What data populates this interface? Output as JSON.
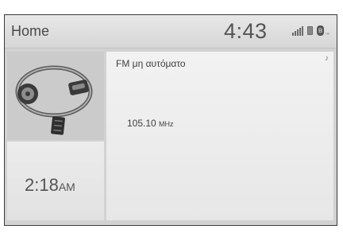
{
  "header": {
    "title": "Home",
    "clock": "4:43"
  },
  "status_icons": [
    "signal-bars-icon",
    "phone-battery-icon",
    "bluetooth-icon",
    "dots-icon"
  ],
  "clock_tile": {
    "time": "2:18",
    "ampm": "AM"
  },
  "audio": {
    "source": "FM μη αυτόματο",
    "frequency_value": "105.10",
    "frequency_unit": "MHz"
  }
}
